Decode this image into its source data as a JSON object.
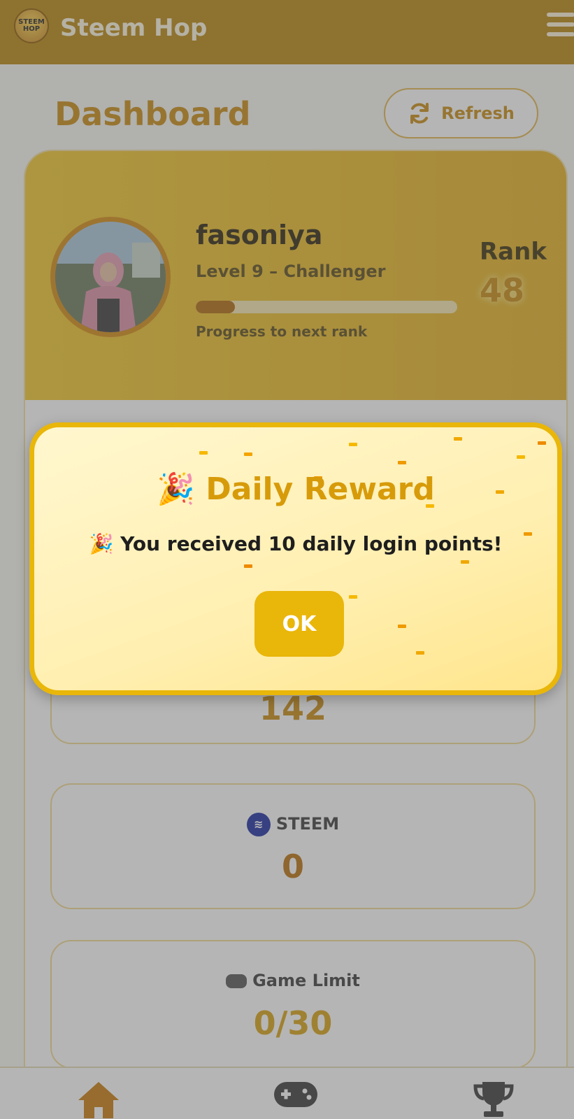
{
  "header": {
    "logo_text_1": "STEEM",
    "logo_text_2": "HOP",
    "app_title": "Steem Hop"
  },
  "page": {
    "title": "Dashboard",
    "refresh_label": "Refresh"
  },
  "profile": {
    "username": "fasoniya",
    "level": "Level 9 – Challenger",
    "progress_fraction": 0.15,
    "progress_label": "Progress to next rank",
    "rank_label": "Rank",
    "rank_value": "48"
  },
  "stats": {
    "points_value": "142",
    "steem_label": "STEEM",
    "steem_value": "0",
    "game_limit_label": "Game Limit",
    "game_limit_value": "0/30"
  },
  "dialog": {
    "title_emoji": "🎉",
    "title": "Daily Reward",
    "message_emoji": "🎉",
    "message": "You received 10 daily login points!",
    "ok_label": "OK"
  },
  "nav": {
    "items": [
      "home-icon",
      "gamepad-icon",
      "trophy-icon"
    ]
  },
  "colors": {
    "brand": "#b8860b",
    "accent": "#e9b60a",
    "gold": "#c88a10"
  }
}
